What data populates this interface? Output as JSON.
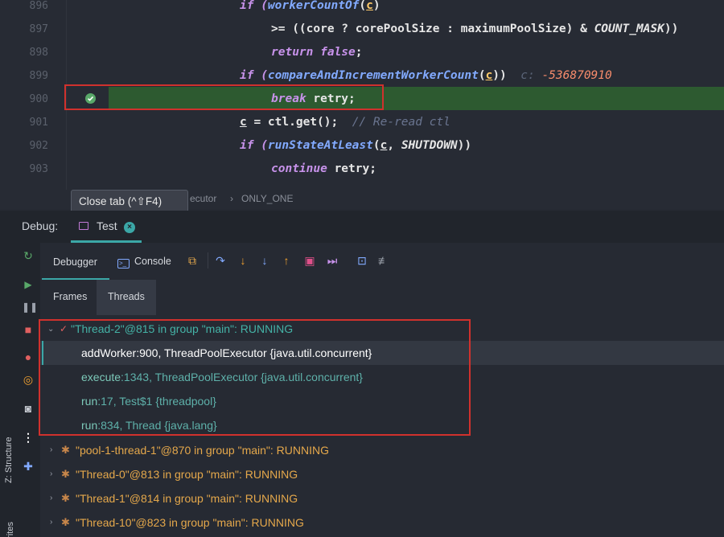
{
  "editor": {
    "lines": [
      {
        "num": "896"
      },
      {
        "num": "897"
      },
      {
        "num": "898"
      },
      {
        "num": "899"
      },
      {
        "num": "900"
      },
      {
        "num": "901"
      },
      {
        "num": "902"
      },
      {
        "num": "903"
      }
    ],
    "code": {
      "l896_if": "if (",
      "l896_fn": "workerCountOf",
      "l896_p1": "(",
      "l896_c": "c",
      "l896_p2": ")",
      "l897_a": ">= ((core ? corePoolSize : maximumPoolSize) & ",
      "l897_const": "COUNT_MASK",
      "l897_b": "))",
      "l898_ret": "return false",
      "l898_semi": ";",
      "l899_if": "if (",
      "l899_fn": "compareAndIncrementWorkerCount",
      "l899_p1": "(",
      "l899_c": "c",
      "l899_p2": "))",
      "l899_hint": "c: ",
      "l899_hintval": "-536870910",
      "l900_kw": "break",
      "l900_rest": " retry;",
      "l901_c": "c",
      "l901_rest": " = ctl.get();  ",
      "l901_cmt": "// Re-read ctl",
      "l902_if": "if (",
      "l902_fn": "runStateAtLeast",
      "l902_p1": "(",
      "l902_c": "c",
      "l902_mid": ", ",
      "l902_const": "SHUTDOWN",
      "l902_p2": "))",
      "l903_kw": "continue",
      "l903_rest": " retry;"
    }
  },
  "breadcrumb": {
    "item1": "ecutor",
    "sep": "›",
    "item2": "ONLY_ONE"
  },
  "tooltip": "Close tab (^⇧F4)",
  "debug": {
    "label": "Debug:",
    "tab_label": "Test",
    "close_glyph": "×"
  },
  "toolbar": {
    "debugger_label": "Debugger",
    "console_label": "Console"
  },
  "subtabs": {
    "frames": "Frames",
    "threads": "Threads"
  },
  "threads": {
    "current": {
      "name": "\"Thread-2\"@815 in group \"main\": RUNNING",
      "frames": [
        {
          "method": "addWorker:900, ThreadPoolExecutor {java.util.concurrent}"
        },
        {
          "method": "execute",
          "rest": ":1343, ThreadPoolExecutor {java.util.concurrent}"
        },
        {
          "method": "run",
          "rest": ":17, Test$1 {threadpool}"
        },
        {
          "method": "run",
          "rest": ":834, Thread {java.lang}"
        }
      ]
    },
    "others": [
      {
        "name": "\"pool-1-thread-1\"@870 in group \"main\": RUNNING"
      },
      {
        "name": "\"Thread-0\"@813 in group \"main\": RUNNING"
      },
      {
        "name": "\"Thread-1\"@814 in group \"main\": RUNNING"
      },
      {
        "name": "\"Thread-10\"@823 in group \"main\": RUNNING"
      }
    ]
  },
  "side": {
    "structure": "Z: Structure",
    "favorites": "orites"
  },
  "colors": {
    "accent": "#3ba7a7",
    "highlight_red": "#d0312d",
    "exec_line": "#2d5a30"
  }
}
